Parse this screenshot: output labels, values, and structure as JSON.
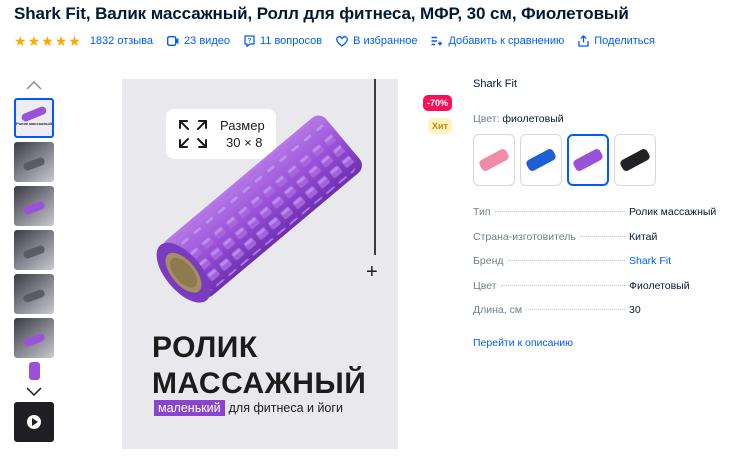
{
  "title": "Shark Fit, Валик массажный, Ролл для фитнеса, МФР, 30 см, Фиолетовый",
  "rating": {
    "stars": 5,
    "reviews": "1832 отзыва"
  },
  "actions": {
    "videos": "23 видео",
    "questions": "11 вопросов",
    "favorites": "В избранное",
    "compare": "Добавить к сравнению",
    "share": "Поделиться"
  },
  "gallery": {
    "first_thumb_text": "Ролик массажный",
    "size_label": "Размер",
    "size_value": "30 × 8",
    "headline_line1": "РОЛИК",
    "headline_line2": "МАССАЖНЫЙ",
    "tag": "маленький",
    "subline": "для фитнеса и йоги"
  },
  "badges": {
    "sale": "-70%",
    "hit": "Хит"
  },
  "brand": "Shark Fit",
  "color": {
    "label": "Цвет:",
    "value": "фиолетовый"
  },
  "swatches": [
    {
      "name": "pink",
      "color": "#f08ba8"
    },
    {
      "name": "blue",
      "color": "#1f5fd6"
    },
    {
      "name": "purple",
      "color": "#9a52d8"
    },
    {
      "name": "black",
      "color": "#222226"
    }
  ],
  "specs": [
    {
      "key": "Тип",
      "value": "Ролик массажный"
    },
    {
      "key": "Страна-изготовитель",
      "value": "Китай"
    },
    {
      "key": "Бренд",
      "value": "Shark Fit"
    },
    {
      "key": "Цвет",
      "value": "Фиолетовый"
    },
    {
      "key": "Длина, см",
      "value": "30"
    }
  ],
  "to_description": "Перейти к описанию",
  "colors": {
    "accent": "#005bff",
    "star": "#ffa800",
    "sale": "#f91155",
    "product": "#9a52d8"
  }
}
